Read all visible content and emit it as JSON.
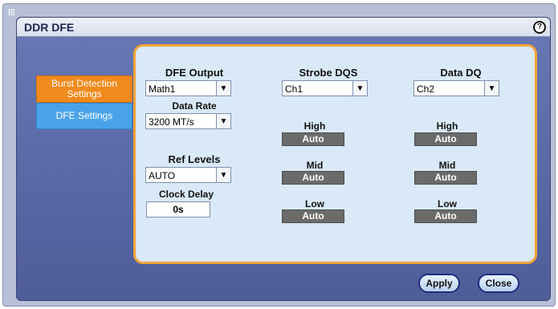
{
  "dialog": {
    "title": "DDR DFE",
    "help_icon_glyph": "?"
  },
  "tabs": [
    {
      "label": "Burst Detection Settings",
      "state": "inactive"
    },
    {
      "label": "DFE Settings",
      "state": "active"
    }
  ],
  "dfe_output": {
    "label": "DFE Output",
    "value": "Math1"
  },
  "data_rate": {
    "label": "Data Rate",
    "value": "3200 MT/s"
  },
  "ref_levels": {
    "label": "Ref Levels",
    "value": "AUTO"
  },
  "clock_delay": {
    "label": "Clock Delay",
    "value": "0s"
  },
  "strobe_dqs": {
    "label": "Strobe DQS",
    "value": "Ch1",
    "high": {
      "label": "High",
      "value": "Auto"
    },
    "mid": {
      "label": "Mid",
      "value": "Auto"
    },
    "low": {
      "label": "Low",
      "value": "Auto"
    }
  },
  "data_dq": {
    "label": "Data DQ",
    "value": "Ch2",
    "high": {
      "label": "High",
      "value": "Auto"
    },
    "mid": {
      "label": "Mid",
      "value": "Auto"
    },
    "low": {
      "label": "Low",
      "value": "Auto"
    }
  },
  "buttons": {
    "apply": "Apply",
    "close": "Close"
  },
  "icons": {
    "dropdown_arrow": "▼"
  },
  "colors": {
    "accent_orange": "#f08a1c",
    "active_tab": "#4aa3ea",
    "panel_bg": "#d9e9f7",
    "dialog_bg": "#5b6ba8"
  }
}
